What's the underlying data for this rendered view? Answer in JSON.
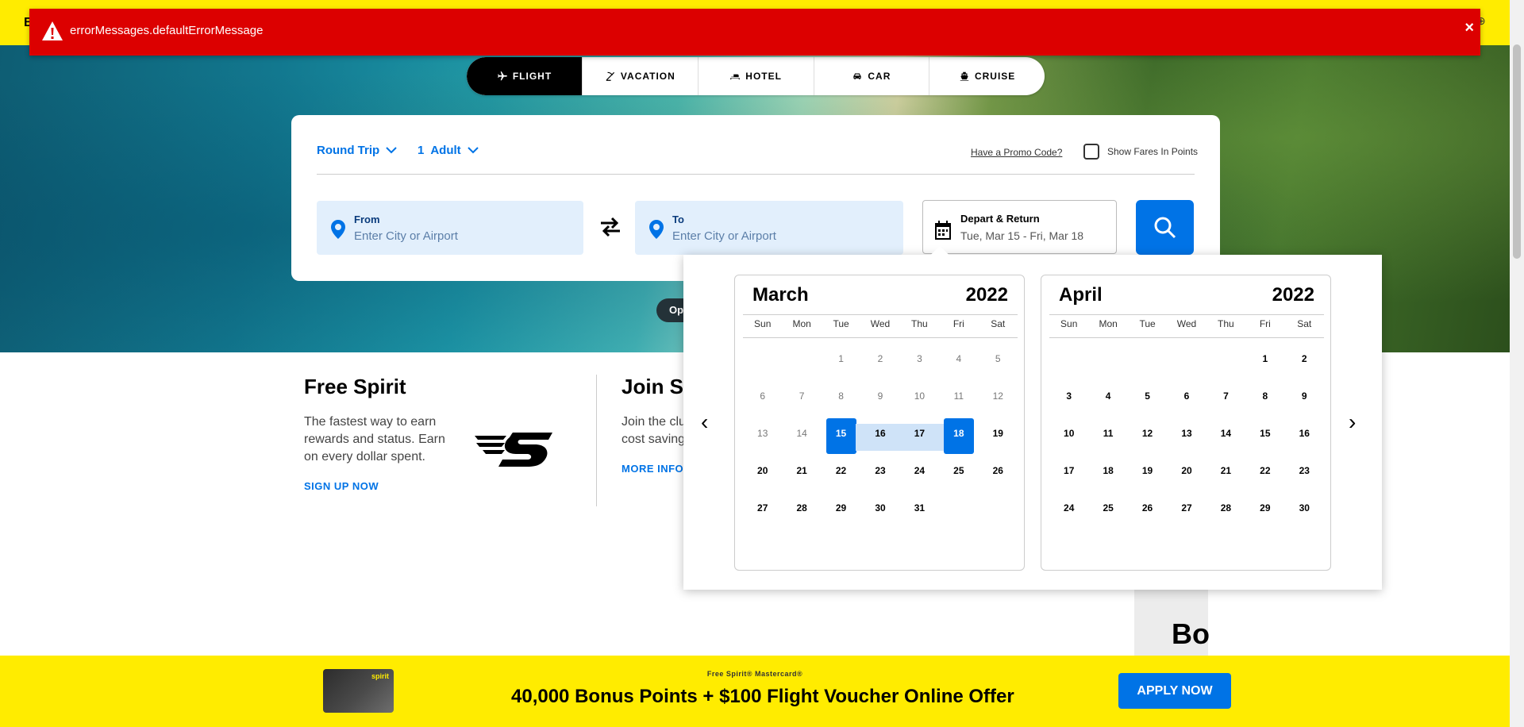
{
  "header": {
    "edge_letter": "B"
  },
  "error": {
    "message": "errorMessages.defaultErrorMessage",
    "close": "×"
  },
  "product_tabs": [
    {
      "label": "FLIGHT",
      "icon": "plane-icon"
    },
    {
      "label": "VACATION",
      "icon": "beach-umbrella-icon"
    },
    {
      "label": "HOTEL",
      "icon": "bed-icon"
    },
    {
      "label": "CAR",
      "icon": "car-icon"
    },
    {
      "label": "CRUISE",
      "icon": "cruise-icon"
    }
  ],
  "booking": {
    "trip_type": "Round Trip",
    "passenger_count": "1",
    "passenger_type": "Adult",
    "promo_link": "Have a Promo Code?",
    "points_label": "Show Fares In Points",
    "from": {
      "label": "From",
      "placeholder": "Enter City or Airport"
    },
    "to": {
      "label": "To",
      "placeholder": "Enter City or Airport"
    },
    "dates": {
      "label": "Depart & Return",
      "value": "Tue, Mar 15 - Fri, Mar 18"
    }
  },
  "hero": {
    "pill_text": "Op"
  },
  "calendar": {
    "prev": "‹",
    "next": "›",
    "days_of_week": [
      "Sun",
      "Mon",
      "Tue",
      "Wed",
      "Thu",
      "Fri",
      "Sat"
    ],
    "selected_start": 15,
    "selected_end": 18,
    "months": [
      {
        "name": "March",
        "year": "2022",
        "first_weekday": 2,
        "days": 31,
        "past_before": 14
      },
      {
        "name": "April",
        "year": "2022",
        "first_weekday": 5,
        "days": 30,
        "past_before": 0
      }
    ]
  },
  "sections": [
    {
      "title": "Free Spirit",
      "text": "The fastest way to earn rewards and status. Earn on every dollar spent.",
      "link": "SIGN UP NOW"
    },
    {
      "title": "Join Sa",
      "text": "Join the clu experience t cost savings",
      "link": "MORE INFO"
    }
  ],
  "grey_panel": {
    "text": "Bo"
  },
  "promo": {
    "card_brand": "spirit",
    "eyebrow": "Free Spirit® Mastercard®",
    "headline": "40,000 Bonus Points + $100 Flight Voucher Online Offer",
    "cta": "APPLY NOW"
  },
  "colors": {
    "brand_yellow": "#ffec00",
    "brand_blue": "#0073e6",
    "error_red": "#dc0000"
  }
}
